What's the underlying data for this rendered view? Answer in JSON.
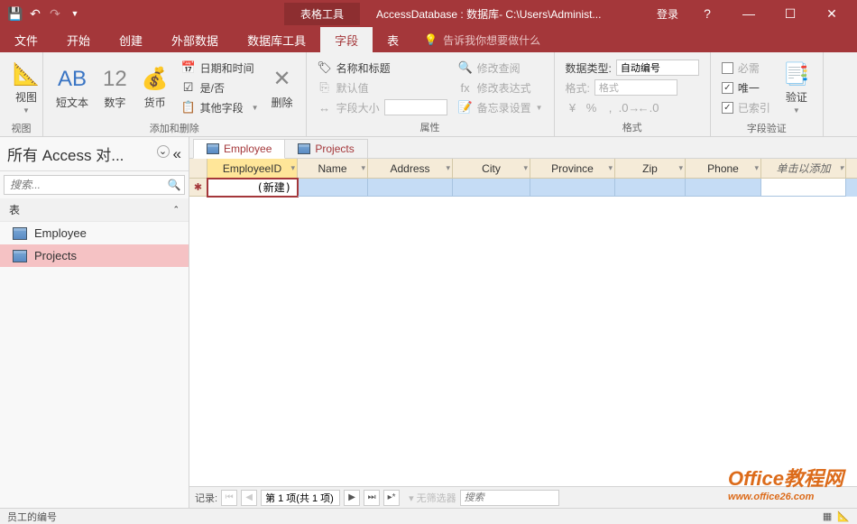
{
  "titlebar": {
    "contextual_tab": "表格工具",
    "title": "AccessDatabase : 数据库- C:\\Users\\Administ...",
    "login": "登录"
  },
  "menu": {
    "tabs": [
      "文件",
      "开始",
      "创建",
      "外部数据",
      "数据库工具",
      "字段",
      "表"
    ],
    "active_index": 5,
    "tellme": "告诉我你想要做什么"
  },
  "ribbon": {
    "g0": {
      "label": "视图",
      "big": "视图"
    },
    "g1": {
      "label": "添加和删除",
      "b1": "AB",
      "b1l": "短文本",
      "b2": "12",
      "b2l": "数字",
      "b3l": "货币",
      "s1": "日期和时间",
      "s2": "是/否",
      "s3": "其他字段",
      "del": "删除"
    },
    "g2": {
      "label": "属性",
      "s1": "名称和标题",
      "s2": "默认值",
      "s3": "字段大小",
      "r1": "修改查阅",
      "r2": "修改表达式",
      "r3": "备忘录设置"
    },
    "g3": {
      "label": "格式",
      "l1": "数据类型:",
      "v1": "自动编号",
      "l2": "格式:",
      "v2": "格式"
    },
    "g4": {
      "label": "字段验证",
      "c1": "必需",
      "c2": "唯一",
      "c3": "已索引",
      "big": "验证"
    }
  },
  "nav": {
    "header": "所有 Access 对...",
    "search_placeholder": "搜索...",
    "section": "表",
    "items": [
      "Employee",
      "Projects"
    ],
    "selected_index": 1
  },
  "docs": {
    "tabs": [
      "Employee",
      "Projects"
    ],
    "active_index": 0
  },
  "table": {
    "columns": [
      "EmployeeID",
      "Name",
      "Address",
      "City",
      "Province",
      "Zip",
      "Phone"
    ],
    "add_col": "单击以添加",
    "selected_col": 0,
    "new_row_value": "(新建)",
    "widths": [
      100,
      78,
      94,
      86,
      94,
      78,
      84,
      94
    ]
  },
  "recnav": {
    "label": "记录:",
    "pos": "第 1 项(共 1 项)",
    "filter": "无筛选器",
    "search": "搜索"
  },
  "status": {
    "left": "员工的编号"
  },
  "watermark": {
    "t1": "Office教程网",
    "t2": "www.office26.com"
  }
}
